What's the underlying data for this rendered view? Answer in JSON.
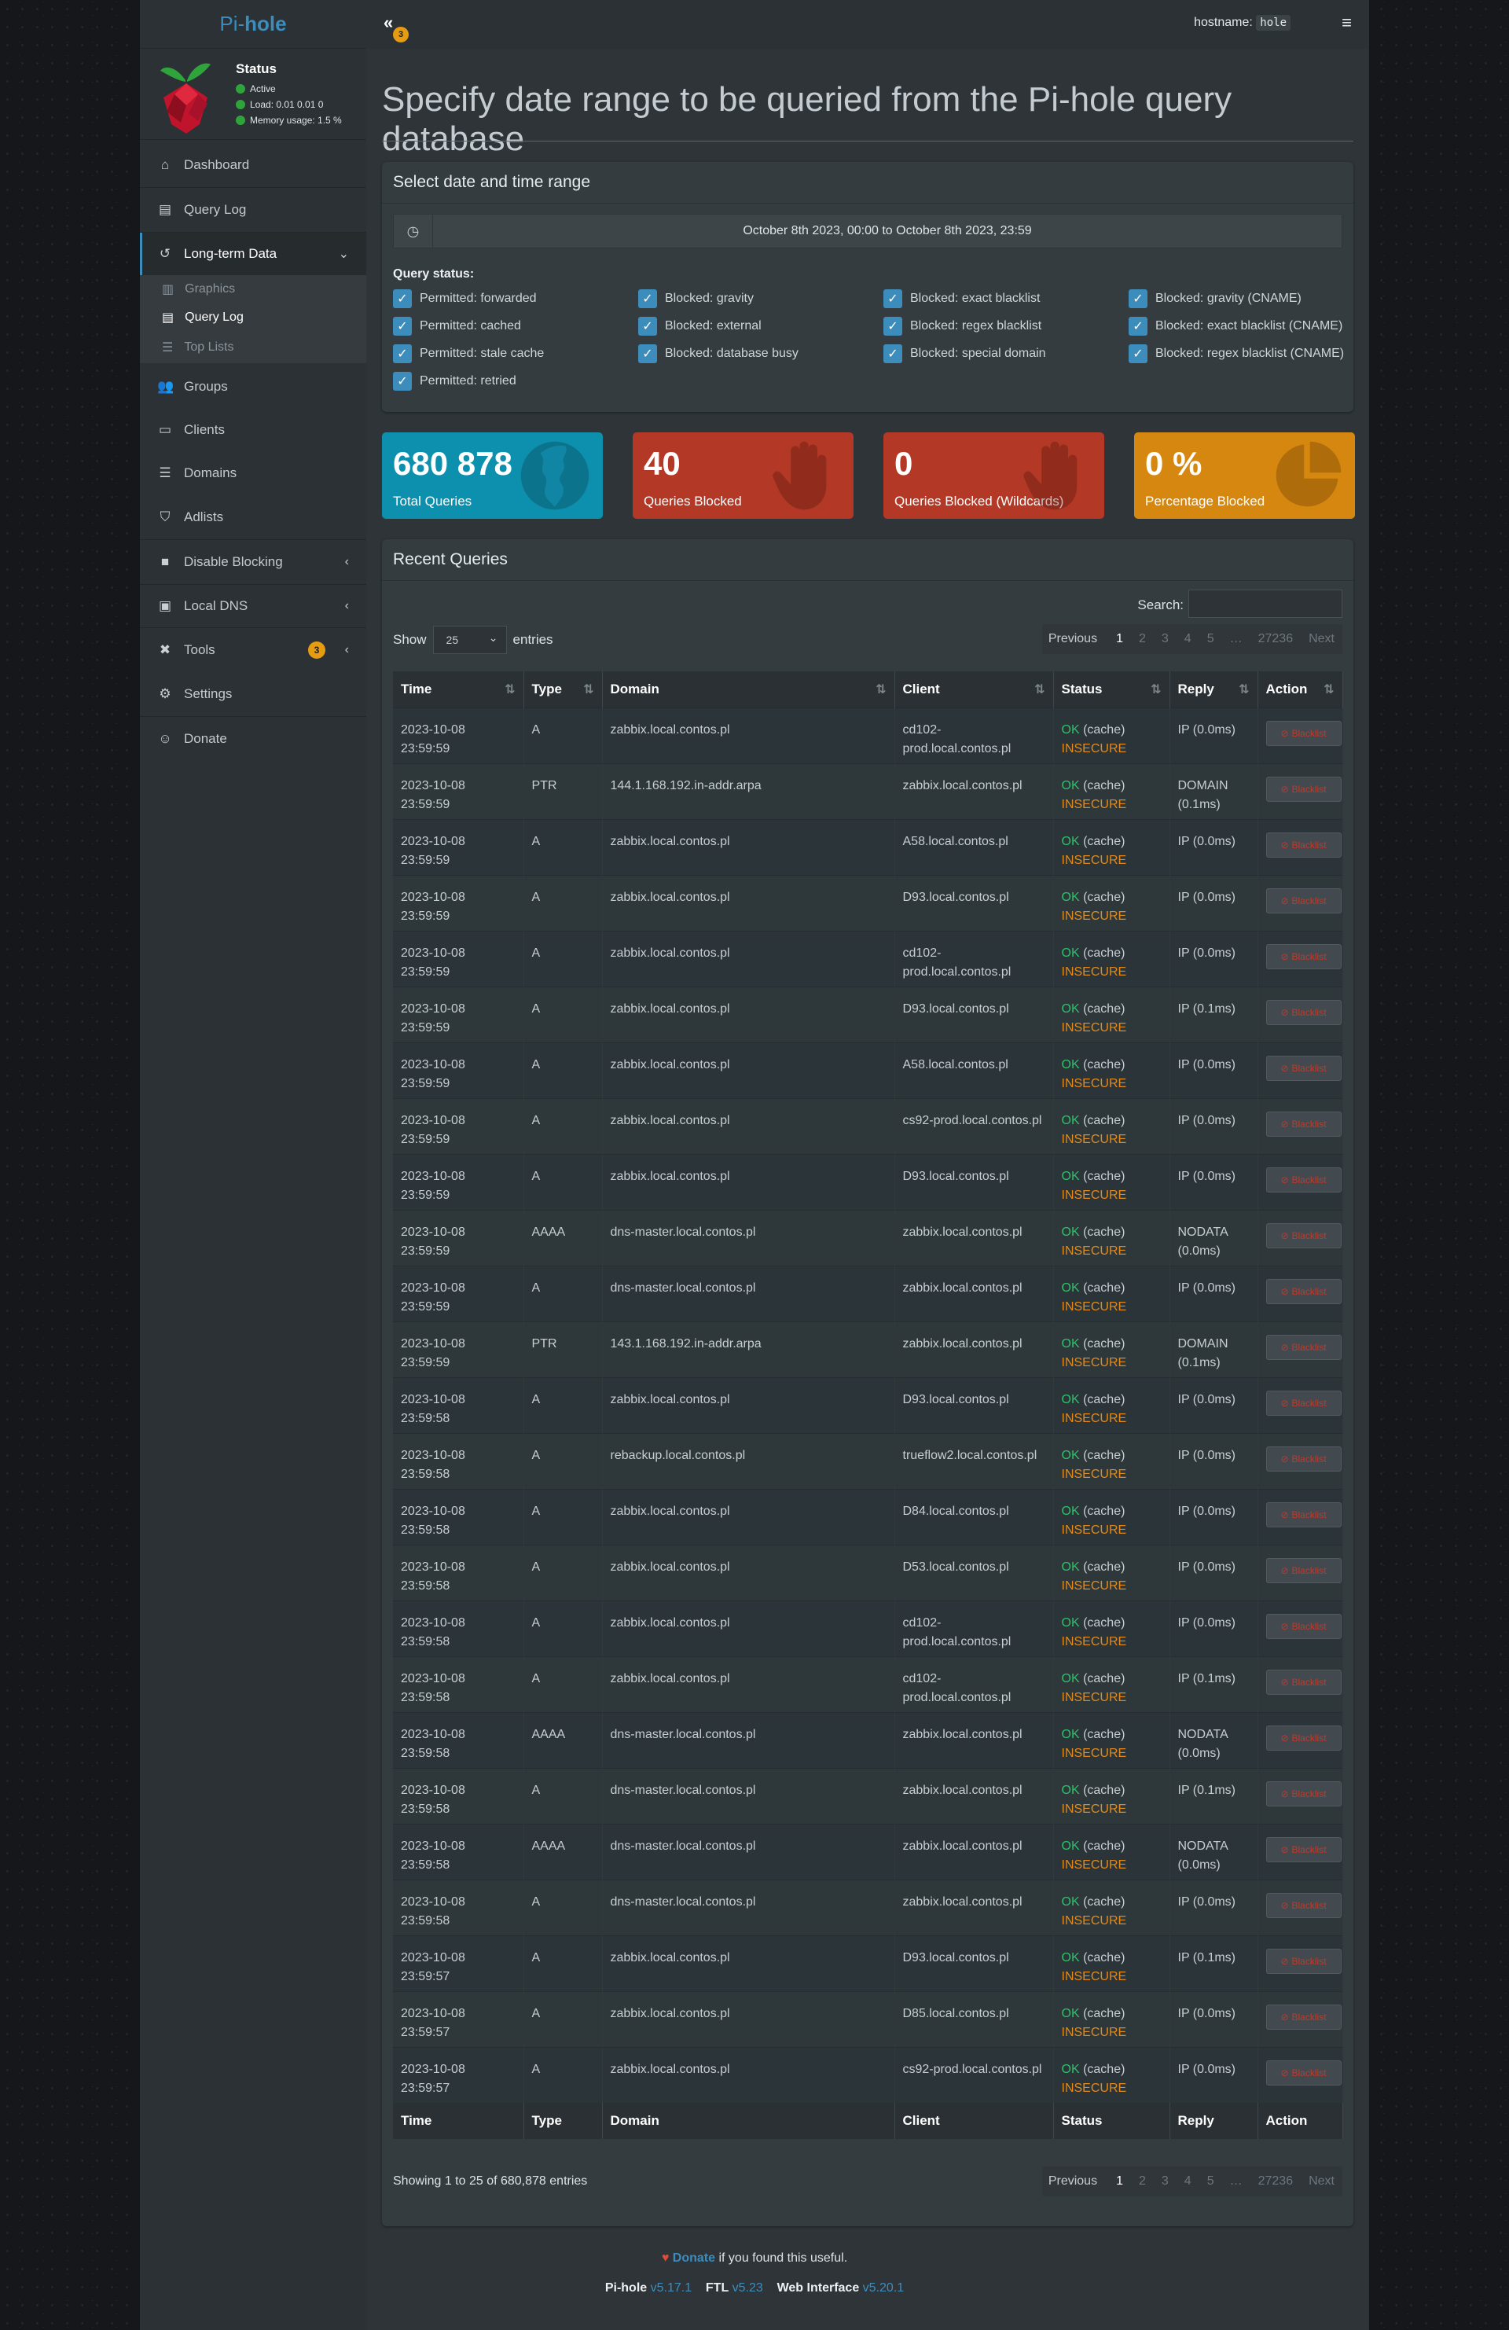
{
  "brand": {
    "prefix": "Pi-",
    "suffix": "hole"
  },
  "status": {
    "title": "Status",
    "active": "Active",
    "load": "Load:  0.01  0.01  0",
    "memory": "Memory usage:  1.5 %"
  },
  "header": {
    "toggle_badge": "3",
    "hostname_label": "hostname:",
    "hostname_value": "hole"
  },
  "nav": {
    "dashboard": "Dashboard",
    "query_log": "Query Log",
    "long_term": "Long-term Data",
    "sub": {
      "graphics": "Graphics",
      "query_log": "Query Log",
      "top_lists": "Top Lists"
    },
    "groups": "Groups",
    "clients": "Clients",
    "domains": "Domains",
    "adlists": "Adlists",
    "disable_blocking": "Disable Blocking",
    "local_dns": "Local DNS",
    "tools": "Tools",
    "tools_badge": "3",
    "settings": "Settings",
    "donate": "Donate"
  },
  "page": {
    "title": "Specify date range to be queried from the Pi-hole query database"
  },
  "daterange": {
    "title": "Select date and time range",
    "value": "October 8th 2023, 00:00 to October 8th 2023, 23:59"
  },
  "query_status": {
    "label": "Query status:",
    "options": [
      "Permitted: forwarded",
      "Blocked: gravity",
      "Blocked: exact blacklist",
      "Blocked: gravity (CNAME)",
      "Permitted: cached",
      "Blocked: external",
      "Blocked: regex blacklist",
      "Blocked: exact blacklist (CNAME)",
      "Permitted: stale cache",
      "Blocked: database busy",
      "Blocked: special domain",
      "Blocked: regex blacklist (CNAME)",
      "Permitted: retried"
    ]
  },
  "stats": [
    {
      "value": "680 878",
      "label": "Total Queries",
      "color": "#0d8fae"
    },
    {
      "value": "40",
      "label": "Queries Blocked",
      "color": "#b33826"
    },
    {
      "value": "0",
      "label": "Queries Blocked (Wildcards)",
      "color": "#b33826"
    },
    {
      "value": "0 %",
      "label": "Percentage Blocked",
      "color": "#d68710"
    }
  ],
  "recent": {
    "title": "Recent Queries",
    "search_label": "Search:",
    "show_label": "Show",
    "entries_label": "entries",
    "page_size": "25",
    "pager": {
      "previous": "Previous",
      "pages": [
        "1",
        "2",
        "3",
        "4",
        "5",
        "…",
        "27236"
      ],
      "next": "Next"
    },
    "columns": [
      "Time",
      "Type",
      "Domain",
      "Client",
      "Status",
      "Reply",
      "Action"
    ],
    "status_ok": "OK",
    "status_cache": "(cache)",
    "status_insecure": "INSECURE",
    "action_label": "Blacklist",
    "rows": [
      [
        "2023-10-08 23:59:59",
        "A",
        "zabbix.local.contos.pl",
        "cd102-prod.local.contos.pl",
        "IP (0.0ms)"
      ],
      [
        "2023-10-08 23:59:59",
        "PTR",
        "144.1.168.192.in-addr.arpa",
        "zabbix.local.contos.pl",
        "DOMAIN (0.1ms)"
      ],
      [
        "2023-10-08 23:59:59",
        "A",
        "zabbix.local.contos.pl",
        "A58.local.contos.pl",
        "IP (0.0ms)"
      ],
      [
        "2023-10-08 23:59:59",
        "A",
        "zabbix.local.contos.pl",
        "D93.local.contos.pl",
        "IP (0.0ms)"
      ],
      [
        "2023-10-08 23:59:59",
        "A",
        "zabbix.local.contos.pl",
        "cd102-prod.local.contos.pl",
        "IP (0.0ms)"
      ],
      [
        "2023-10-08 23:59:59",
        "A",
        "zabbix.local.contos.pl",
        "D93.local.contos.pl",
        "IP (0.1ms)"
      ],
      [
        "2023-10-08 23:59:59",
        "A",
        "zabbix.local.contos.pl",
        "A58.local.contos.pl",
        "IP (0.0ms)"
      ],
      [
        "2023-10-08 23:59:59",
        "A",
        "zabbix.local.contos.pl",
        "cs92-prod.local.contos.pl",
        "IP (0.0ms)"
      ],
      [
        "2023-10-08 23:59:59",
        "A",
        "zabbix.local.contos.pl",
        "D93.local.contos.pl",
        "IP (0.0ms)"
      ],
      [
        "2023-10-08 23:59:59",
        "AAAA",
        "dns-master.local.contos.pl",
        "zabbix.local.contos.pl",
        "NODATA (0.0ms)"
      ],
      [
        "2023-10-08 23:59:59",
        "A",
        "dns-master.local.contos.pl",
        "zabbix.local.contos.pl",
        "IP (0.0ms)"
      ],
      [
        "2023-10-08 23:59:59",
        "PTR",
        "143.1.168.192.in-addr.arpa",
        "zabbix.local.contos.pl",
        "DOMAIN (0.1ms)"
      ],
      [
        "2023-10-08 23:59:58",
        "A",
        "zabbix.local.contos.pl",
        "D93.local.contos.pl",
        "IP (0.0ms)"
      ],
      [
        "2023-10-08 23:59:58",
        "A",
        "rebackup.local.contos.pl",
        "trueflow2.local.contos.pl",
        "IP (0.0ms)"
      ],
      [
        "2023-10-08 23:59:58",
        "A",
        "zabbix.local.contos.pl",
        "D84.local.contos.pl",
        "IP (0.0ms)"
      ],
      [
        "2023-10-08 23:59:58",
        "A",
        "zabbix.local.contos.pl",
        "D53.local.contos.pl",
        "IP (0.0ms)"
      ],
      [
        "2023-10-08 23:59:58",
        "A",
        "zabbix.local.contos.pl",
        "cd102-prod.local.contos.pl",
        "IP (0.0ms)"
      ],
      [
        "2023-10-08 23:59:58",
        "A",
        "zabbix.local.contos.pl",
        "cd102-prod.local.contos.pl",
        "IP (0.1ms)"
      ],
      [
        "2023-10-08 23:59:58",
        "AAAA",
        "dns-master.local.contos.pl",
        "zabbix.local.contos.pl",
        "NODATA (0.0ms)"
      ],
      [
        "2023-10-08 23:59:58",
        "A",
        "dns-master.local.contos.pl",
        "zabbix.local.contos.pl",
        "IP (0.1ms)"
      ],
      [
        "2023-10-08 23:59:58",
        "AAAA",
        "dns-master.local.contos.pl",
        "zabbix.local.contos.pl",
        "NODATA (0.0ms)"
      ],
      [
        "2023-10-08 23:59:58",
        "A",
        "dns-master.local.contos.pl",
        "zabbix.local.contos.pl",
        "IP (0.0ms)"
      ],
      [
        "2023-10-08 23:59:57",
        "A",
        "zabbix.local.contos.pl",
        "D93.local.contos.pl",
        "IP (0.1ms)"
      ],
      [
        "2023-10-08 23:59:57",
        "A",
        "zabbix.local.contos.pl",
        "D85.local.contos.pl",
        "IP (0.0ms)"
      ],
      [
        "2023-10-08 23:59:57",
        "A",
        "zabbix.local.contos.pl",
        "cs92-prod.local.contos.pl",
        "IP (0.0ms)"
      ]
    ],
    "showing": "Showing 1 to 25 of 680,878 entries"
  },
  "footer": {
    "donate": "Donate",
    "donate_suffix": " if you found this useful.",
    "pihole_label": "Pi-hole",
    "pihole_ver": "v5.17.1",
    "ftl_label": "FTL",
    "ftl_ver": "v5.23",
    "web_label": "Web Interface",
    "web_ver": "v5.20.1"
  }
}
